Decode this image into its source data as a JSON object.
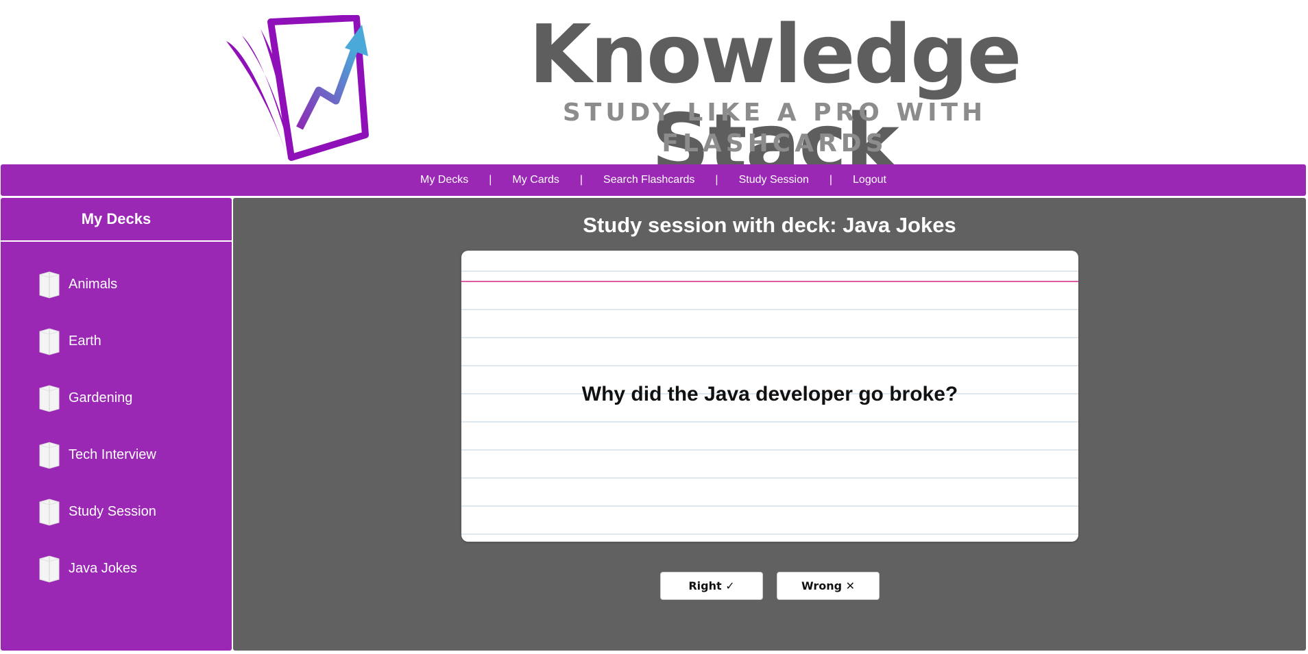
{
  "header": {
    "title": "Knowledge Stack",
    "tagline_line1": "STUDY LIKE A PRO WITH",
    "tagline_line2": "FLASHCARDS",
    "logo_icon": "flashcard-stack-logo"
  },
  "nav": {
    "items": [
      {
        "label": "My Decks"
      },
      {
        "label": "My Cards"
      },
      {
        "label": "Search Flashcards"
      },
      {
        "label": "Study Session"
      },
      {
        "label": "Logout"
      }
    ],
    "separator": "|"
  },
  "sidebar": {
    "title": "My Decks",
    "decks": [
      {
        "label": "Animals",
        "icon": "deck-icon"
      },
      {
        "label": "Earth",
        "icon": "deck-icon"
      },
      {
        "label": "Gardening",
        "icon": "deck-icon"
      },
      {
        "label": "Tech Interview",
        "icon": "deck-icon"
      },
      {
        "label": "Study Session",
        "icon": "deck-icon"
      },
      {
        "label": "Java Jokes",
        "icon": "deck-icon"
      }
    ]
  },
  "session": {
    "title": "Study session with deck: Java Jokes",
    "card_text": "Why did the Java developer go broke?",
    "right_label": "Right ✓",
    "wrong_label": "Wrong ✕"
  },
  "colors": {
    "brand_purple": "#9b27b5",
    "main_gray": "#616161",
    "title_gray": "#5e5e5e",
    "card_red_line": "#e05aa8"
  }
}
